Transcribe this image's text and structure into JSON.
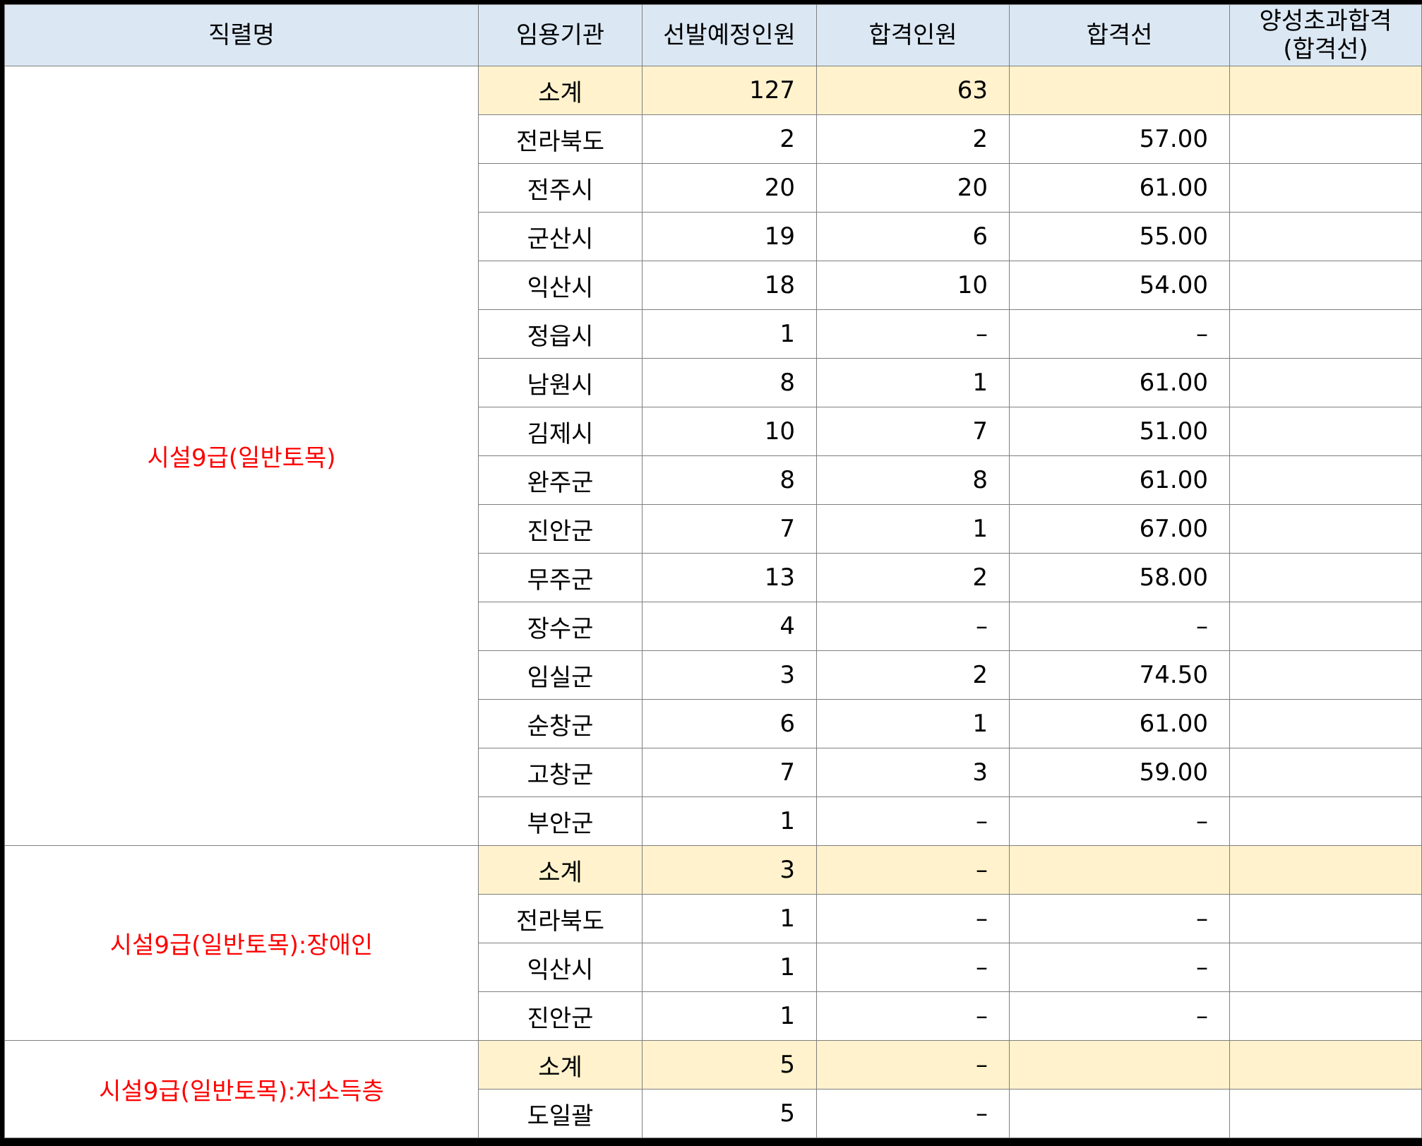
{
  "colors": {
    "header_bg": "#dbe8f4",
    "subtotal_bg": "#fff2cc",
    "job_text": "#ff0000"
  },
  "headers": {
    "job": "직렬명",
    "agency": "임용기관",
    "planned": "선발예정인원",
    "passed": "합격인원",
    "cutoff": "합격선",
    "extra": "양성초과합격\n(합격선)"
  },
  "groups": [
    {
      "job": "시설9급(일반토목)",
      "subtotal": {
        "label": "소계",
        "planned": "127",
        "passed": "63",
        "cutoff": "",
        "extra": ""
      },
      "rows": [
        {
          "agency": "전라북도",
          "planned": "2",
          "passed": "2",
          "cutoff": "57.00",
          "extra": ""
        },
        {
          "agency": "전주시",
          "planned": "20",
          "passed": "20",
          "cutoff": "61.00",
          "extra": ""
        },
        {
          "agency": "군산시",
          "planned": "19",
          "passed": "6",
          "cutoff": "55.00",
          "extra": ""
        },
        {
          "agency": "익산시",
          "planned": "18",
          "passed": "10",
          "cutoff": "54.00",
          "extra": ""
        },
        {
          "agency": "정읍시",
          "planned": "1",
          "passed": "–",
          "cutoff": "–",
          "extra": ""
        },
        {
          "agency": "남원시",
          "planned": "8",
          "passed": "1",
          "cutoff": "61.00",
          "extra": ""
        },
        {
          "agency": "김제시",
          "planned": "10",
          "passed": "7",
          "cutoff": "51.00",
          "extra": ""
        },
        {
          "agency": "완주군",
          "planned": "8",
          "passed": "8",
          "cutoff": "61.00",
          "extra": ""
        },
        {
          "agency": "진안군",
          "planned": "7",
          "passed": "1",
          "cutoff": "67.00",
          "extra": ""
        },
        {
          "agency": "무주군",
          "planned": "13",
          "passed": "2",
          "cutoff": "58.00",
          "extra": ""
        },
        {
          "agency": "장수군",
          "planned": "4",
          "passed": "–",
          "cutoff": "–",
          "extra": ""
        },
        {
          "agency": "임실군",
          "planned": "3",
          "passed": "2",
          "cutoff": "74.50",
          "extra": ""
        },
        {
          "agency": "순창군",
          "planned": "6",
          "passed": "1",
          "cutoff": "61.00",
          "extra": ""
        },
        {
          "agency": "고창군",
          "planned": "7",
          "passed": "3",
          "cutoff": "59.00",
          "extra": ""
        },
        {
          "agency": "부안군",
          "planned": "1",
          "passed": "–",
          "cutoff": "–",
          "extra": ""
        }
      ]
    },
    {
      "job": "시설9급(일반토목):장애인",
      "subtotal": {
        "label": "소계",
        "planned": "3",
        "passed": "–",
        "cutoff": "",
        "extra": ""
      },
      "rows": [
        {
          "agency": "전라북도",
          "planned": "1",
          "passed": "–",
          "cutoff": "–",
          "extra": ""
        },
        {
          "agency": "익산시",
          "planned": "1",
          "passed": "–",
          "cutoff": "–",
          "extra": ""
        },
        {
          "agency": "진안군",
          "planned": "1",
          "passed": "–",
          "cutoff": "–",
          "extra": ""
        }
      ]
    },
    {
      "job": "시설9급(일반토목):저소득층",
      "subtotal": {
        "label": "소계",
        "planned": "5",
        "passed": "–",
        "cutoff": "",
        "extra": ""
      },
      "rows": [
        {
          "agency": "도일괄",
          "planned": "5",
          "passed": "–",
          "cutoff": "",
          "extra": ""
        }
      ]
    }
  ]
}
